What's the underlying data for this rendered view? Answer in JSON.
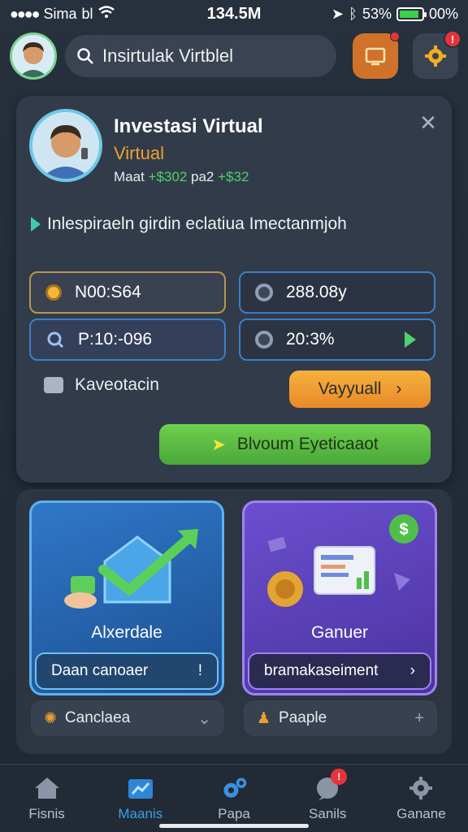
{
  "status_bar": {
    "carrier": "Sima",
    "carrier_suffix": "bl",
    "time": "134.5M",
    "battery_text": "00%",
    "battery_pct_text": "53%",
    "battery_level": 0.9
  },
  "top_bar": {
    "search_text": "Insirtulak Virtblel",
    "gear_badge": "!"
  },
  "profile": {
    "title": "Investasi Virtual",
    "subtitle": "Virtual",
    "meta_prefix": "Maat",
    "meta_green1": "+$302",
    "meta_mid": "pa2",
    "meta_green2": "+$32"
  },
  "section_label": "Inlespiraeln girdin eclatiua Imectanmjoh",
  "stats": {
    "s1": "N00:S64",
    "s2": "P:10:-096",
    "s3": "288.08y",
    "s4": "20:3%"
  },
  "actions": {
    "kav_label": "Kaveotacin",
    "orange_button": "Vayyuall",
    "green_button": "Blvoum Eyeticaaot"
  },
  "tiles": [
    {
      "label": "Alxerdale",
      "button": "Daan canoaer",
      "button_mark": "!"
    },
    {
      "label": "Ganuer",
      "button": "bramakaseiment",
      "button_mark": "›"
    }
  ],
  "pills": [
    {
      "label": "Canclaea",
      "end": "⌄"
    },
    {
      "label": "Paaple",
      "end": "+"
    }
  ],
  "nav": [
    {
      "label": "Fisnis",
      "icon": "home-icon"
    },
    {
      "label": "Maanis",
      "icon": "chart-icon"
    },
    {
      "label": "Papa",
      "icon": "gear-cluster-icon"
    },
    {
      "label": "Sanils",
      "icon": "chat-icon",
      "badge": "!"
    },
    {
      "label": "Ganane",
      "icon": "settings-icon"
    }
  ],
  "colors": {
    "accent_blue": "#3aa0e8",
    "accent_orange": "#f0a030",
    "accent_green": "#4fd26b",
    "badge_red": "#e8333b"
  }
}
